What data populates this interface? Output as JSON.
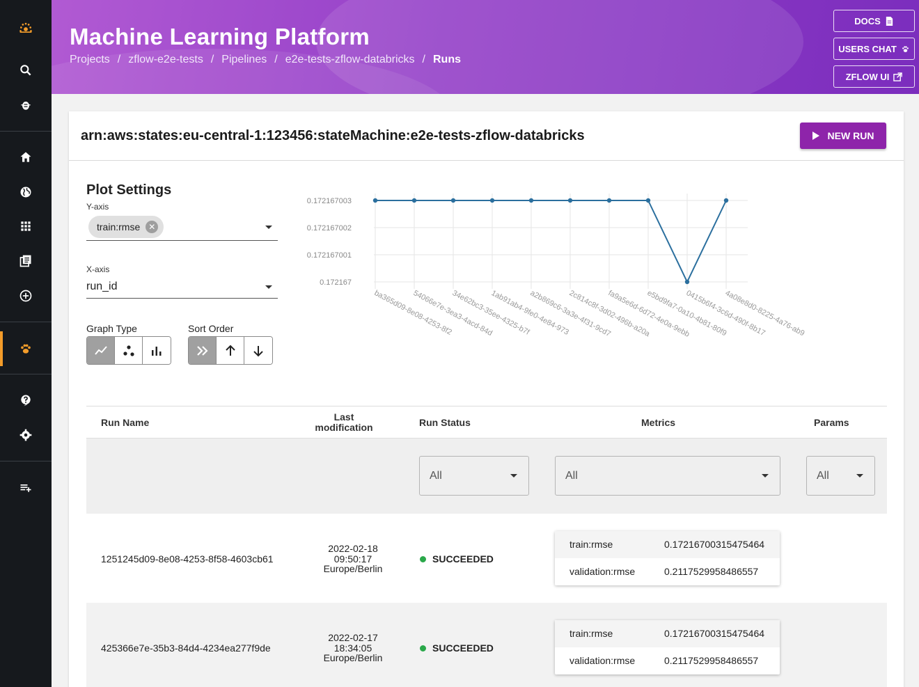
{
  "header": {
    "title": "Machine Learning Platform",
    "breadcrumb": [
      "Projects",
      "zflow-e2e-tests",
      "Pipelines",
      "e2e-tests-zflow-databricks",
      "Runs"
    ],
    "buttons": {
      "docs": "DOCS",
      "users_chat": "USERS CHAT",
      "zflow_ui": "ZFLOW UI"
    }
  },
  "card": {
    "title": "arn:aws:states:eu-central-1:123456:stateMachine:e2e-tests-zflow-databricks",
    "new_run_label": "NEW RUN"
  },
  "plot_settings": {
    "title": "Plot Settings",
    "y_axis_label": "Y-axis",
    "y_axis_chip": "train:rmse",
    "x_axis_label": "X-axis",
    "x_axis_value": "run_id",
    "graph_type_label": "Graph Type",
    "sort_order_label": "Sort Order"
  },
  "chart_data": {
    "type": "line",
    "x": [
      "ba365d09-8e08-4253-8f2",
      "54066e7e-3ea3-4acd-84d",
      "34e62bc3-35ee-4325-b7f",
      "1ab91ab4-9fe0-4e84-973",
      "a2b869c6-3a3e-4f31-9cd7",
      "2c814c8f-3d02-496b-a20a",
      "fa9a5e6d-6d72-4e0a-9ebb",
      "e5bd9fa7-0a10-4b81-80f9",
      "0415b6f4-3c6d-490f-8b17",
      "4a08e8d0-8225-4a76-ab9"
    ],
    "y": [
      0.172167003,
      0.172167003,
      0.172167003,
      0.172167003,
      0.172167003,
      0.172167003,
      0.172167003,
      0.172167003,
      0.172167,
      0.172167003
    ],
    "y_ticks": [
      "0.172167003",
      "0.172167002",
      "0.172167001",
      "0.172167"
    ],
    "ylim": [
      0.172167,
      0.172167003
    ],
    "color": "#2b6f9e",
    "grid": true
  },
  "table": {
    "headers": {
      "run_name": "Run Name",
      "last_mod_1": "Last",
      "last_mod_2": "modification",
      "run_status": "Run Status",
      "metrics": "Metrics",
      "params": "Params"
    },
    "filters": {
      "status": "All",
      "metrics": "All",
      "params": "All"
    },
    "rows": [
      {
        "run_name": "1251245d09-8e08-4253-8f58-4603cb61",
        "date": "2022-02-18",
        "time": "09:50:17",
        "tz": "Europe/Berlin",
        "status": "SUCCEEDED",
        "metrics": [
          {
            "key": "train:rmse",
            "value": "0.17216700315475464"
          },
          {
            "key": "validation:rmse",
            "value": "0.2117529958486557"
          }
        ]
      },
      {
        "run_name": "425366e7e-35b3-84d4-4234ea277f9de",
        "date": "2022-02-17",
        "time": "18:34:05",
        "tz": "Europe/Berlin",
        "status": "SUCCEEDED",
        "metrics": [
          {
            "key": "train:rmse",
            "value": "0.17216700315475464"
          },
          {
            "key": "validation:rmse",
            "value": "0.2117529958486557"
          }
        ]
      }
    ]
  },
  "colors": {
    "accent": "#8e24aa",
    "sidebar": "#16191d",
    "active": "#f39c2a",
    "success": "#2aa84a"
  }
}
